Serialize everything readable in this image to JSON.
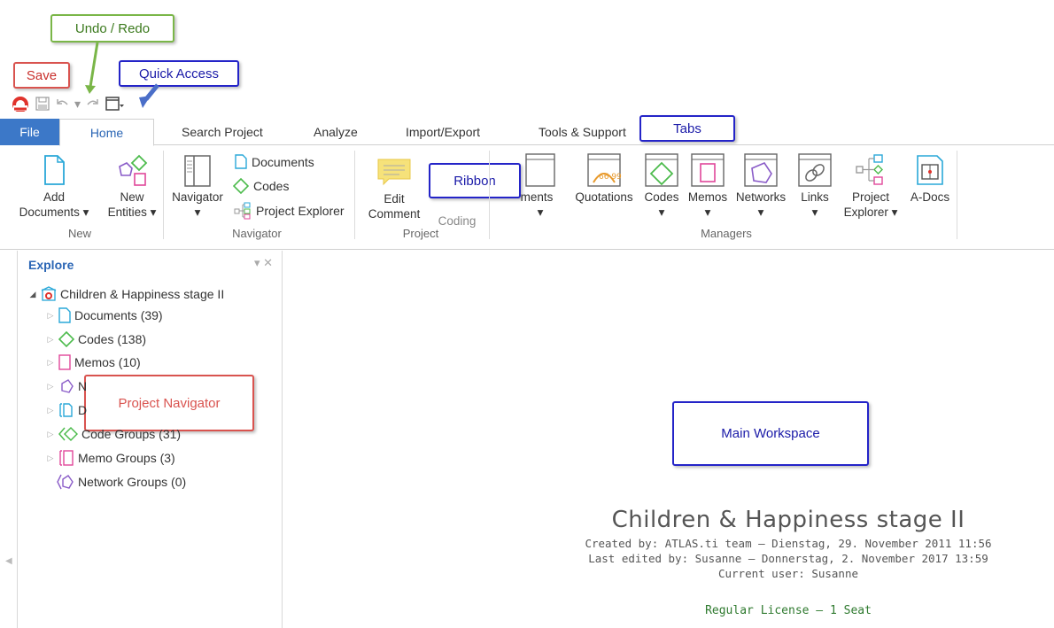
{
  "callouts": {
    "undo_redo": "Undo / Redo",
    "save": "Save",
    "quick_access": "Quick Access",
    "tabs": "Tabs",
    "ribbon": "Ribbon",
    "project_navigator": "Project Navigator",
    "main_workspace": "Main Workspace"
  },
  "tabs": [
    "File",
    "Home",
    "Search Project",
    "Analyze",
    "Import/Export",
    "Tools & Support"
  ],
  "ribbon": {
    "new": {
      "add_documents_1": "Add",
      "add_documents_2": "Documents ▾",
      "new_entities_1": "New",
      "new_entities_2": "Entities ▾",
      "label": "New"
    },
    "navigator": {
      "navigator_btn": "Navigator",
      "navigator_arrow": "▾",
      "documents": "Documents",
      "codes": "Codes",
      "project_explorer": "Project Explorer",
      "label": "Navigator"
    },
    "project": {
      "edit_1": "Edit",
      "edit_2": "Comment",
      "coding": "Coding",
      "label": "Project"
    },
    "managers": {
      "documents": "ments",
      "quotations": "Quotations",
      "codes": "Codes",
      "memos": "Memos",
      "networks": "Networks",
      "links": "Links",
      "project_1": "Project",
      "project_2": "Explorer ▾",
      "adocs": "A-Docs",
      "arrow": "▾",
      "label": "Managers"
    }
  },
  "explore": {
    "title": "Explore",
    "controls": "▾ ✕",
    "root": "Children & Happiness stage II",
    "items": [
      "Documents (39)",
      "Codes (138)",
      "Memos (10)",
      "N",
      "D",
      "Code Groups (31)",
      "Memo Groups (3)",
      "Network Groups (0)"
    ]
  },
  "main": {
    "title": "Children & Happiness stage II",
    "created": "Created by: ATLAS.ti team – Dienstag, 29. November 2011 11:56",
    "edited": "Last edited by: Susanne – Donnerstag, 2. November 2017 13:59",
    "user": "Current user: Susanne",
    "license": "Regular License – 1 Seat"
  },
  "colors": {
    "accent": "#3c78c8",
    "callout_blue": "#2424c8",
    "callout_red": "#d9534f",
    "callout_green": "#7ab648",
    "license_green": "#2f7a2f"
  }
}
